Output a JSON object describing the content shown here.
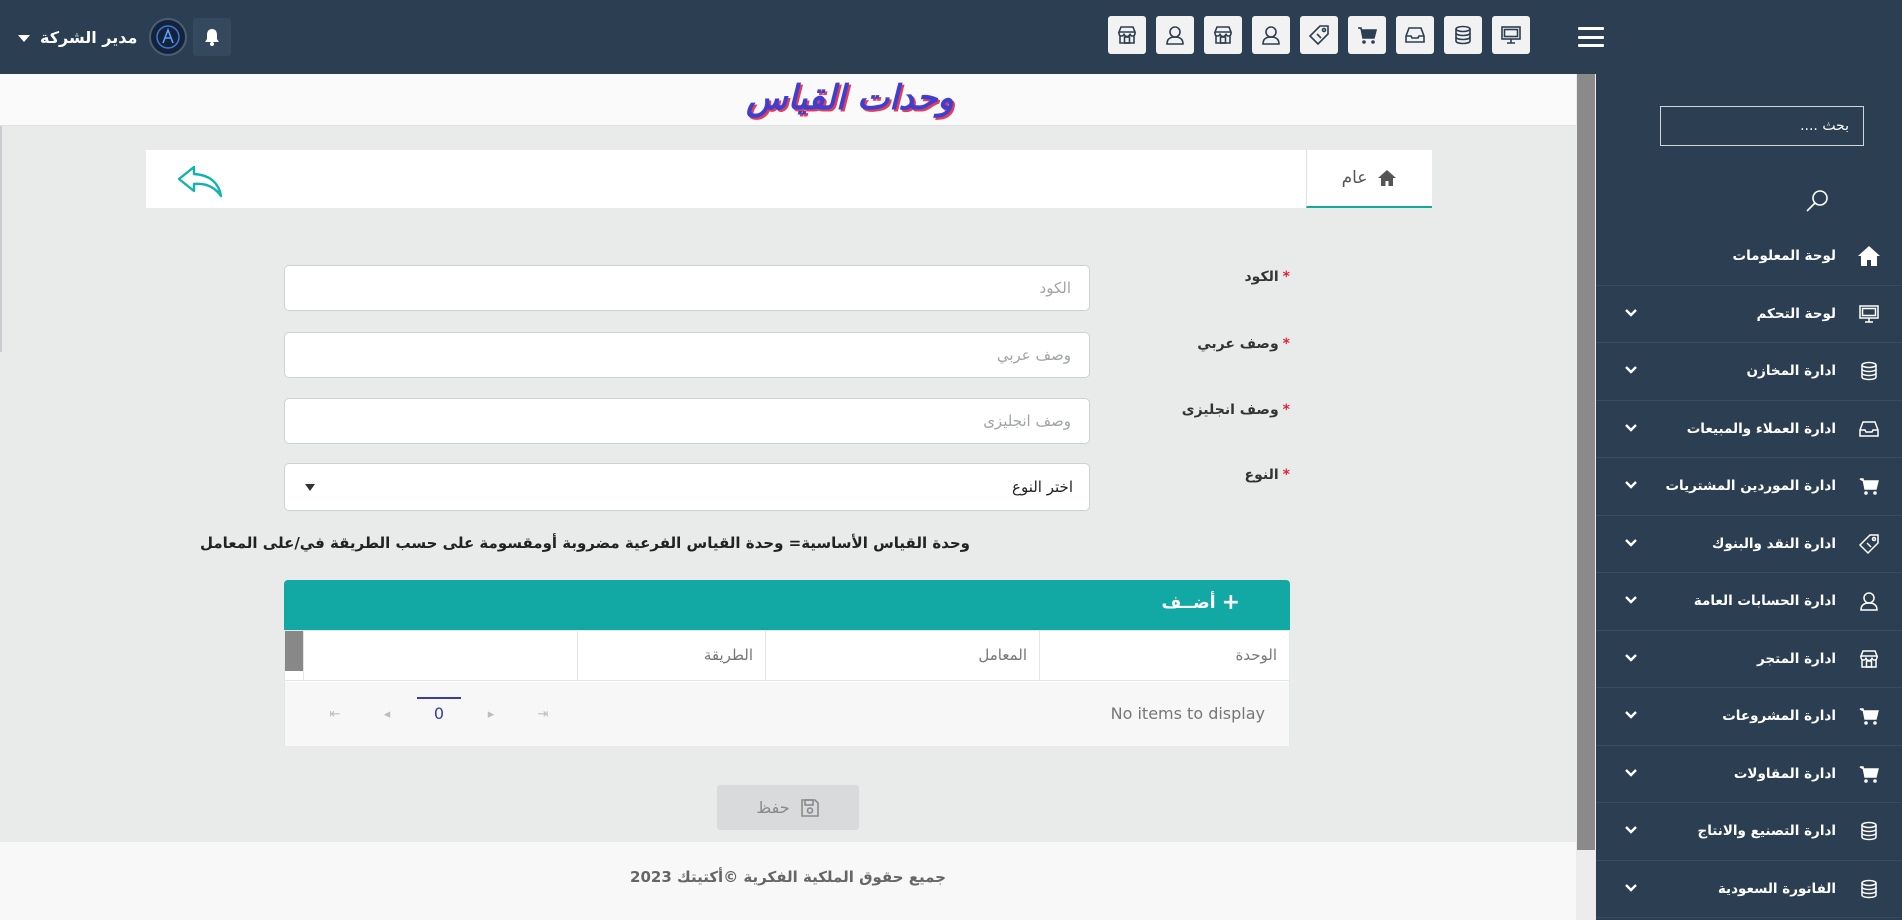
{
  "header": {
    "user_name": "مدير الشركة",
    "toolbar_icons": [
      "store-icon",
      "user-icon",
      "store-icon",
      "user-icon",
      "money-tag-icon",
      "cart-icon",
      "inbox-icon",
      "database-icon",
      "monitor-icon"
    ]
  },
  "sidebar": {
    "search_placeholder": "بحث ....",
    "items": [
      {
        "label": "لوحة المعلومات",
        "icon": "home-icon",
        "has_chevron": false
      },
      {
        "label": "لوحة التحكم",
        "icon": "monitor-icon",
        "has_chevron": true
      },
      {
        "label": "ادارة المخازن",
        "icon": "database-icon",
        "has_chevron": true
      },
      {
        "label": "ادارة العملاء والمبيعات",
        "icon": "inbox-icon",
        "has_chevron": true
      },
      {
        "label": "ادارة الموردين المشتريات",
        "icon": "cart-icon",
        "has_chevron": true
      },
      {
        "label": "ادارة النقد والبنوك",
        "icon": "money-tag-icon",
        "has_chevron": true
      },
      {
        "label": "ادارة الحسابات العامة",
        "icon": "user-icon",
        "has_chevron": true
      },
      {
        "label": "ادارة المتجر",
        "icon": "store-icon",
        "has_chevron": true
      },
      {
        "label": "ادارة المشروعات",
        "icon": "cart-icon",
        "has_chevron": true
      },
      {
        "label": "ادارة المقاولات",
        "icon": "cart-icon",
        "has_chevron": true
      },
      {
        "label": "ادارة التصنيع والانتاج",
        "icon": "database-icon",
        "has_chevron": true
      },
      {
        "label": "الفاتورة السعودية",
        "icon": "database-icon",
        "has_chevron": true
      }
    ]
  },
  "page": {
    "title": "وحدات القياس",
    "tab_general": "عام"
  },
  "form": {
    "code": {
      "label": "الكود",
      "placeholder": "الكود",
      "value": ""
    },
    "arabic_desc": {
      "label": "وصف عربي",
      "placeholder": "وصف عربي",
      "value": ""
    },
    "english_desc": {
      "label": "وصف انجليزى",
      "placeholder": "وصف انجليزى",
      "value": ""
    },
    "type": {
      "label": "النوع",
      "selected": "اختر النوع"
    },
    "required_mark": "*",
    "hint": "وحدة القياس الأساسية= وحدة القياس الفرعية مضروبة أومقسومة على حسب الطريقة في/على المعامل"
  },
  "grid": {
    "add_label": "أضــف",
    "columns": [
      "الوحدة",
      "المعامل",
      "الطريقة",
      ""
    ],
    "empty_text": "No items to display",
    "current_page": "0"
  },
  "actions": {
    "save_label": "حفظ"
  },
  "footer": {
    "copyright": "جميع حقوق الملكية الفكرية ©أكتيتك 2023"
  },
  "colors": {
    "navbar": "#2b3e52",
    "accent_teal": "#12a9a5",
    "title_blue": "#3f3fcf",
    "title_shadow": "#e23c5b",
    "required_red": "#e0243a"
  }
}
